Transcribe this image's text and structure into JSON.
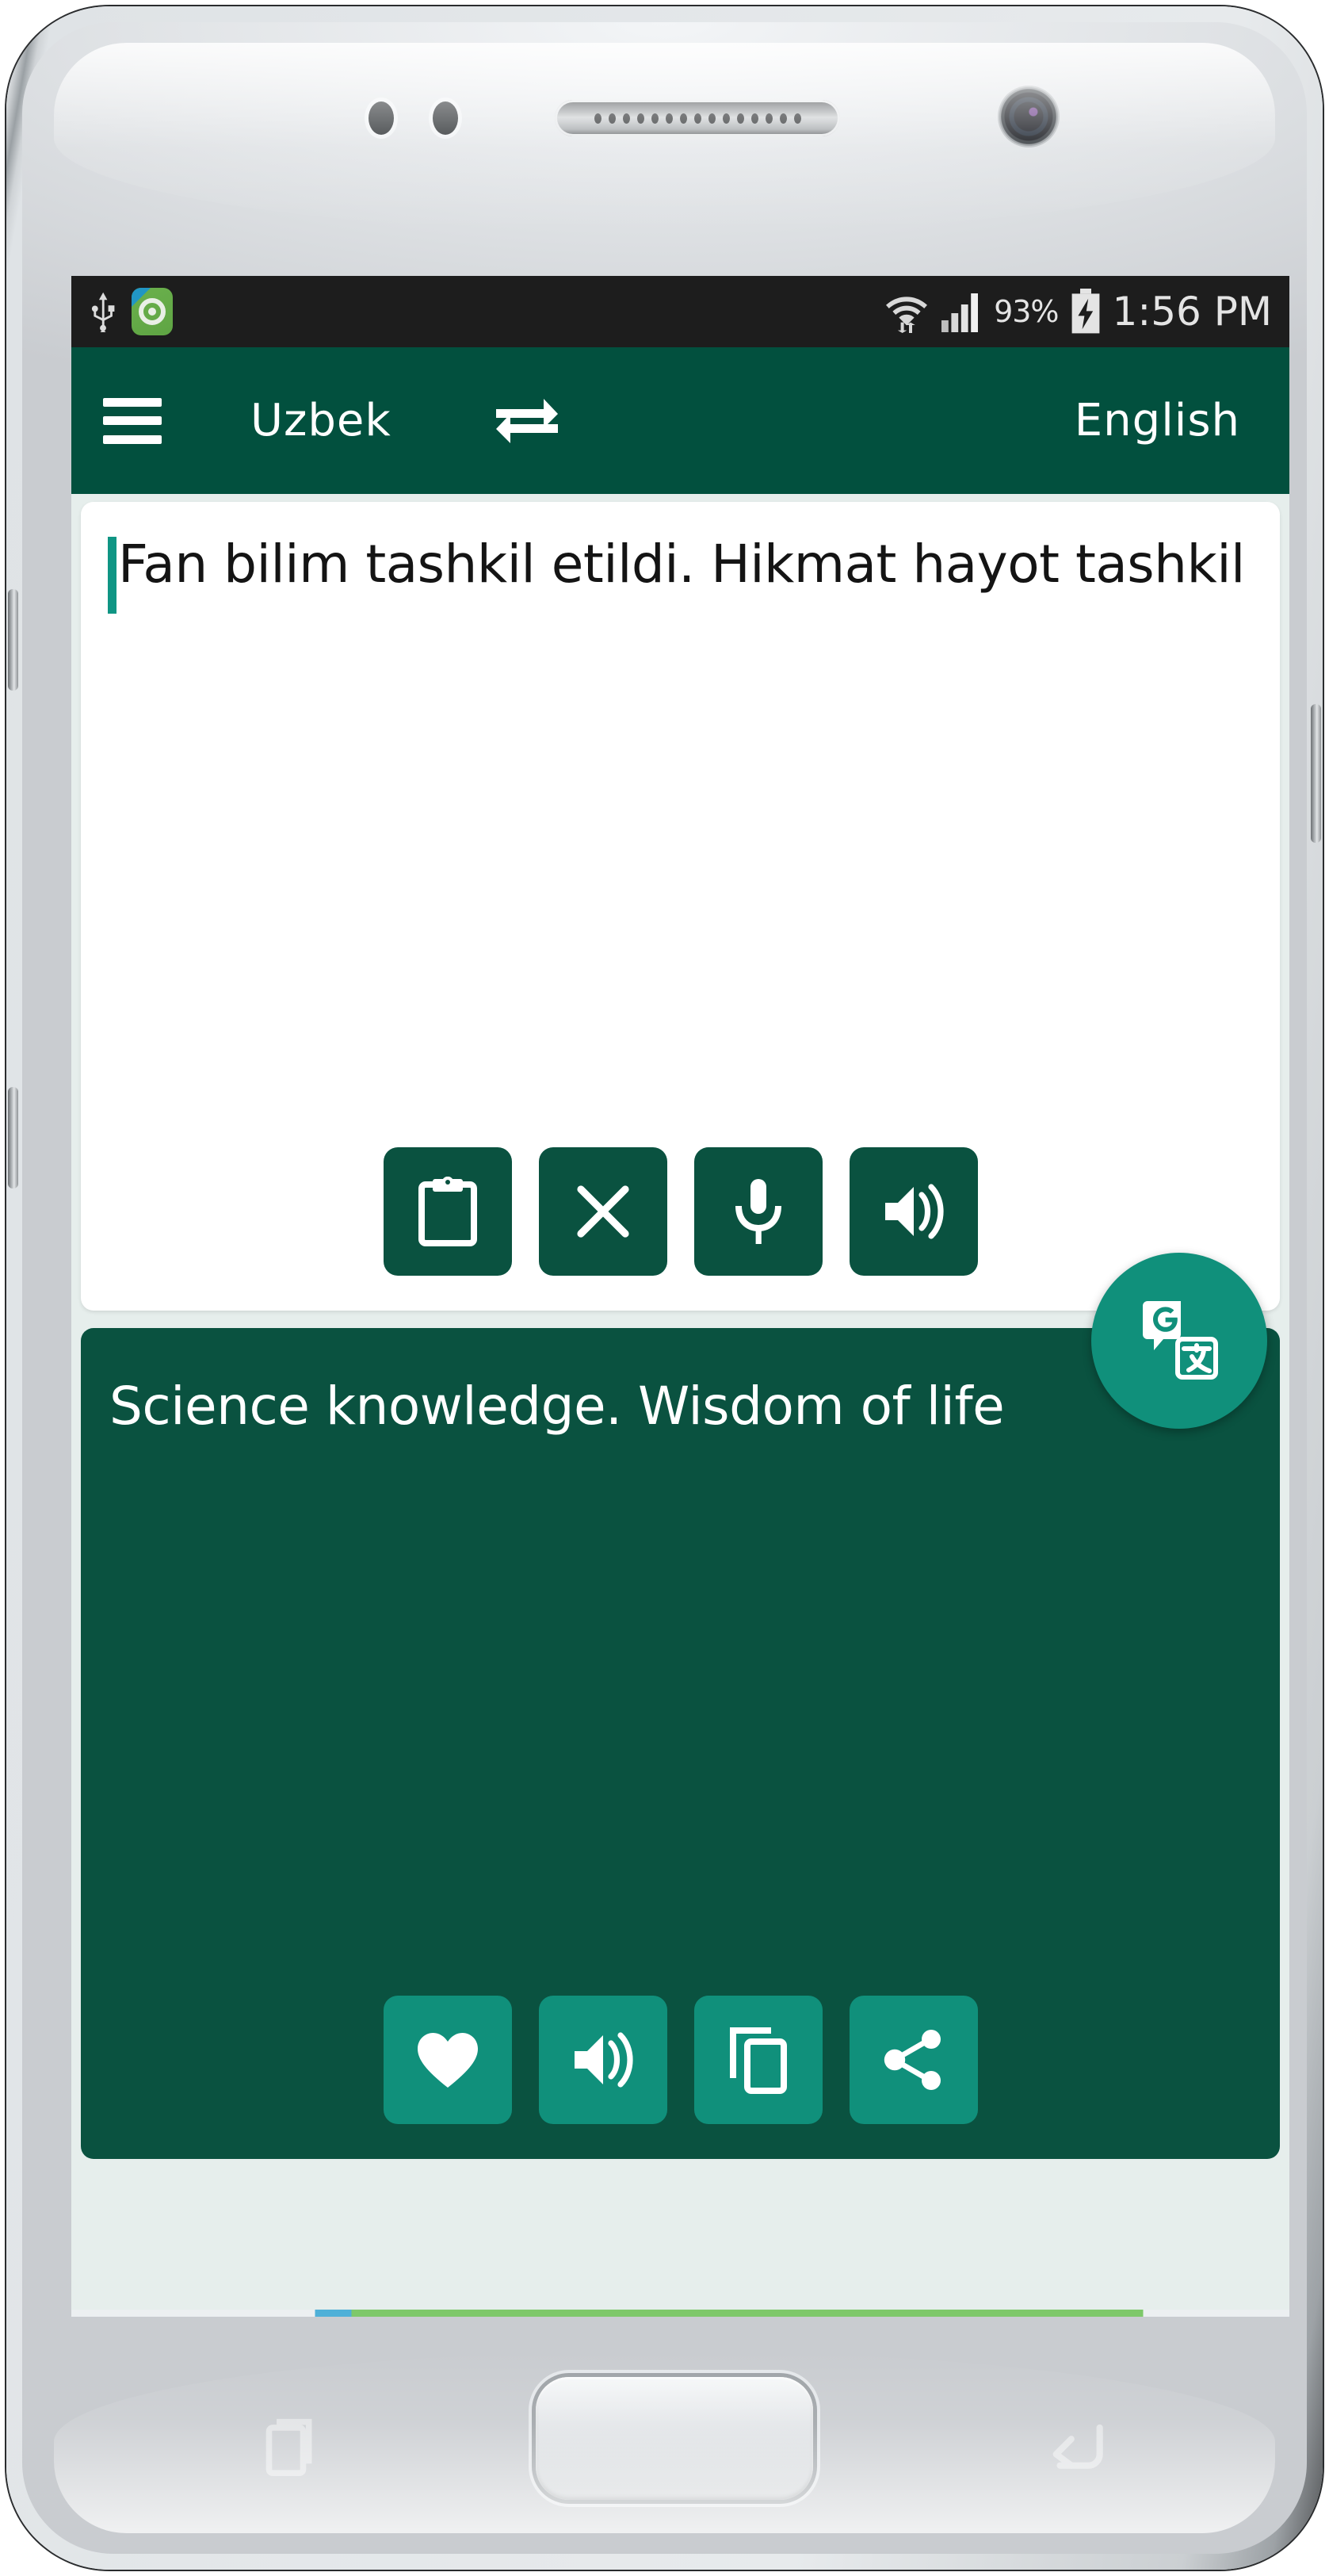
{
  "device": {
    "hardware": {
      "earpiece": "earpiece-speaker-grille",
      "front_camera": "front-camera",
      "home_button": "home-button",
      "nav_recents": "recents-icon",
      "nav_back": "back-icon",
      "volume_up": "volume-up-button",
      "volume_down": "volume-down-button",
      "power": "power-button"
    }
  },
  "statusbar": {
    "background": "#1d1d1d",
    "left_icons": [
      "usb-icon",
      "app-notification-icon"
    ],
    "wifi": "wifi-icon",
    "signal": "cellular-signal-icon",
    "battery_percent": "93%",
    "battery": "battery-charging-icon",
    "time": "1:56 PM"
  },
  "appbar": {
    "background": "#02503e",
    "menu": "hamburger-menu-icon",
    "source_language": "Uzbek",
    "swap": "swap-languages-icon",
    "target_language": "English"
  },
  "input_card": {
    "background": "#ffffff",
    "text": "Fan bilim tashkil etildi. Hikmat hayot tashkil",
    "caret_color": "#0f9584",
    "actions": [
      {
        "name": "paste-button",
        "icon": "clipboard-icon"
      },
      {
        "name": "clear-button",
        "icon": "close-icon"
      },
      {
        "name": "voice-input-button",
        "icon": "microphone-icon"
      },
      {
        "name": "speak-source-button",
        "icon": "speaker-icon"
      }
    ]
  },
  "output_card": {
    "background": "#0a5240",
    "text": "Science knowledge. Wisdom of life",
    "actions": [
      {
        "name": "favorite-button",
        "icon": "heart-icon"
      },
      {
        "name": "speak-translation-button",
        "icon": "speaker-icon"
      },
      {
        "name": "copy-button",
        "icon": "copy-icon"
      },
      {
        "name": "share-button",
        "icon": "share-icon"
      }
    ]
  },
  "fab": {
    "name": "google-translate-fab",
    "icon": "google-translate-icon",
    "color": "#10907b"
  },
  "colors": {
    "dark_green": "#02503e",
    "card_green": "#0a5240",
    "teal": "#10907b",
    "screen_bg": "#e6eeec"
  }
}
